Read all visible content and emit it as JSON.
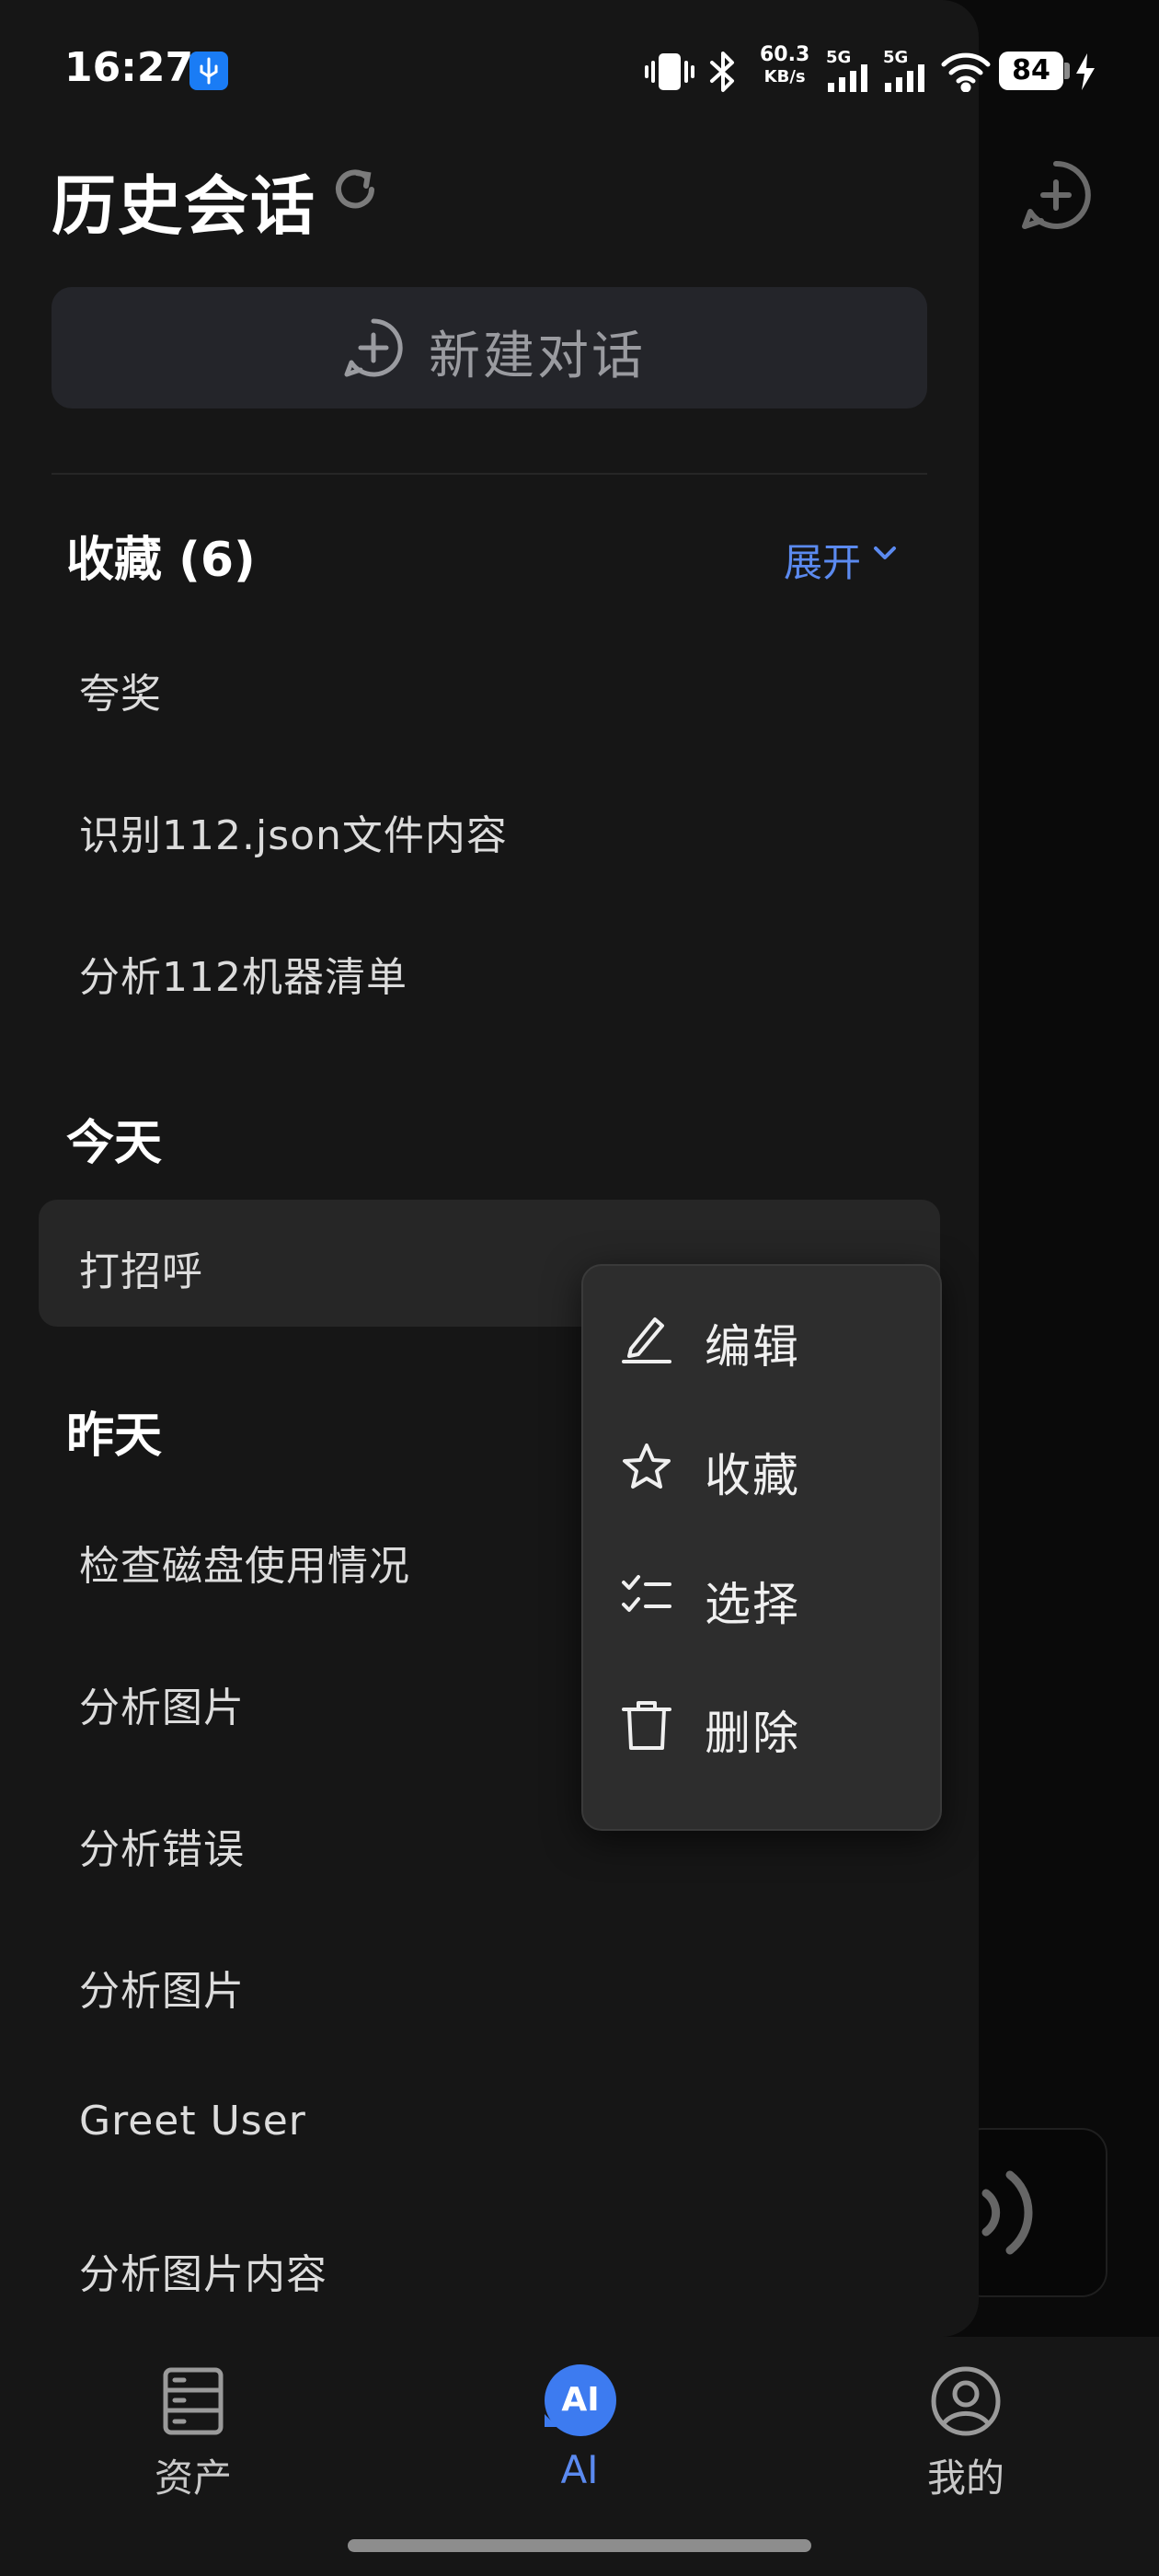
{
  "status_bar": {
    "time": "16:27",
    "net_speed_value": "60.3",
    "net_speed_unit": "KB/s",
    "signal_1": "5G",
    "signal_2": "5G",
    "battery": "84"
  },
  "header": {
    "title": "历史会话",
    "new_chat_label": "新建对话"
  },
  "favorites": {
    "title": "收藏 (6)",
    "expand_label": "展开",
    "items": [
      "夸奖",
      "识别112.json文件内容",
      "分析112机器清单"
    ]
  },
  "today": {
    "title": "今天",
    "items": [
      "打招呼"
    ]
  },
  "yesterday": {
    "title": "昨天",
    "items": [
      "检查磁盘使用情况",
      "分析图片",
      "分析错误",
      "分析图片",
      "Greet User",
      "分析图片内容"
    ]
  },
  "context_menu": {
    "items": [
      {
        "label": "编辑",
        "icon": "edit-icon"
      },
      {
        "label": "收藏",
        "icon": "star-icon"
      },
      {
        "label": "选择",
        "icon": "checklist-icon"
      },
      {
        "label": "删除",
        "icon": "trash-icon"
      }
    ]
  },
  "bottom_nav": {
    "tabs": [
      {
        "label": "资产",
        "icon": "server-icon"
      },
      {
        "label": "AI",
        "icon": "ai-chat-icon"
      },
      {
        "label": "我的",
        "icon": "user-icon"
      }
    ],
    "active": "AI",
    "ai_badge": "AI"
  },
  "colors": {
    "accent": "#5b8af0",
    "drawer_bg": "#161616",
    "menu_bg": "#2d2d2d"
  }
}
